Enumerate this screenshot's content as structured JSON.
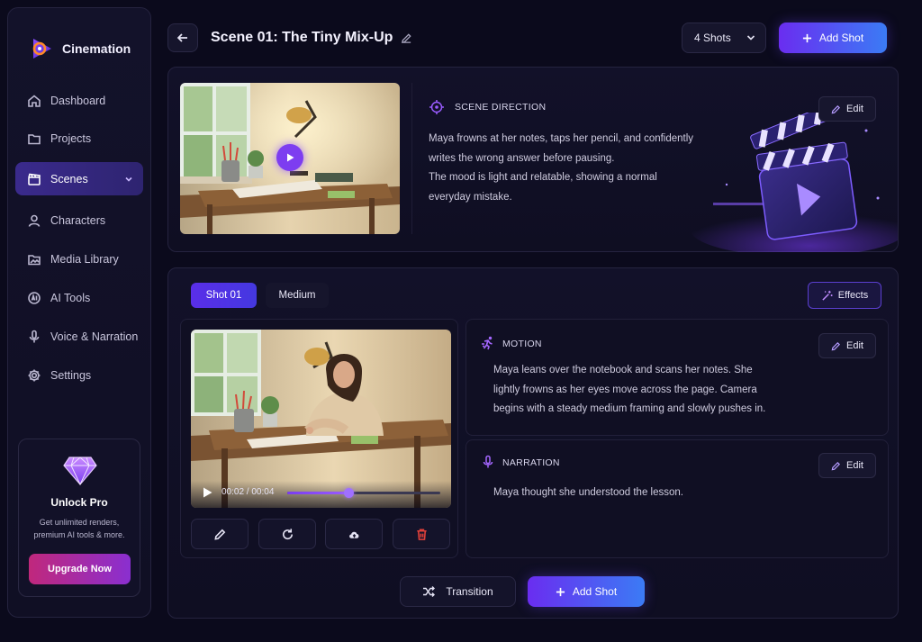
{
  "app": {
    "name": "Cinemation"
  },
  "sidebar": {
    "items": [
      {
        "label": "Dashboard",
        "icon": "home-icon"
      },
      {
        "label": "Projects",
        "icon": "folder-icon"
      },
      {
        "label": "Scenes",
        "icon": "clapperboard-icon",
        "active": true
      },
      {
        "label": "Characters",
        "icon": "user-icon"
      },
      {
        "label": "Media Library",
        "icon": "image-folder-icon"
      },
      {
        "label": "AI Tools",
        "icon": "ai-icon"
      },
      {
        "label": "Voice & Narration",
        "icon": "microphone-icon"
      },
      {
        "label": "Settings",
        "icon": "gear-icon"
      }
    ],
    "promo": {
      "title": "Unlock Pro",
      "subtitle": "Get unlimited renders, premium AI tools & more.",
      "button": "Upgrade Now",
      "icon": "diamond-icon"
    }
  },
  "header": {
    "title": "Scene 01: The Tiny Mix-Up",
    "shots_select": "4 Shots",
    "add_shot": "Add Shot"
  },
  "scene_direction": {
    "label": "SCENE DIRECTION",
    "edit": "Edit",
    "lines": [
      "Maya frowns at her notes, taps her pencil, and confidently",
      "writes the wrong answer before pausing.",
      "The mood is light and relatable, showing a normal",
      "everyday mistake."
    ]
  },
  "shot": {
    "tabs": [
      "Shot 01",
      "Medium"
    ],
    "effects": "Effects",
    "player": {
      "time": "00:02 / 00:04",
      "progress": 0.4
    },
    "motion": {
      "label": "MOTION",
      "edit": "Edit",
      "lines": [
        "Maya leans over the notebook and scans her notes. She",
        "lightly frowns as her eyes move across the page. Camera",
        "begins with a steady medium framing and slowly pushes in."
      ]
    },
    "narration": {
      "label": "NARRATION",
      "edit": "Edit",
      "text": "Maya thought she understood the lesson."
    }
  },
  "footer": {
    "transition": "Transition",
    "add_shot": "Add Shot"
  },
  "colors": {
    "accent": "#6a2df0",
    "accent2": "#3b7bf5",
    "danger": "#e0403a",
    "bg": "#0b0a1c"
  }
}
